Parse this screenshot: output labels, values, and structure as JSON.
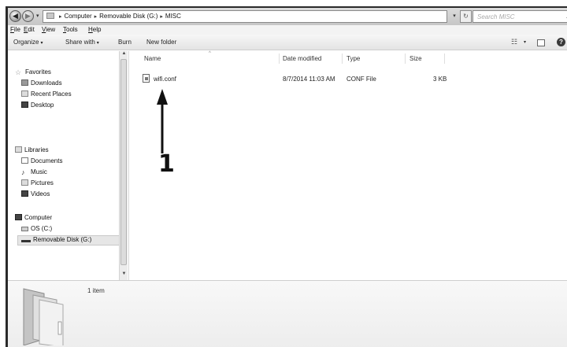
{
  "address_bar": {
    "back_symbol": "◀",
    "forward_symbol": "▶",
    "recent_symbol": "▾",
    "breadcrumbs": [
      "Computer",
      "Removable Disk (G:)",
      "MISC"
    ],
    "separator": "▸",
    "dropdown_symbol": "▾",
    "refresh_symbol": "↻",
    "search_placeholder": "Search MISC",
    "search_icon": "magnifier-icon",
    "search_glyph": "⌕"
  },
  "menu": [
    {
      "key": "F",
      "rest": "ile"
    },
    {
      "key": "E",
      "rest": "dit"
    },
    {
      "key": "V",
      "rest": "iew"
    },
    {
      "key": "T",
      "rest": "ools"
    },
    {
      "key": "H",
      "rest": "elp"
    }
  ],
  "toolbar": {
    "organize": "Organize",
    "share_with": "Share with",
    "burn": "Burn",
    "new_folder": "New folder",
    "caret": "▾",
    "view_glyph": "☷",
    "help_glyph": "?"
  },
  "nav": {
    "favorites": {
      "label": "Favorites",
      "glyph": "☆",
      "items": [
        "Downloads",
        "Recent Places",
        "Desktop"
      ]
    },
    "libraries": {
      "label": "Libraries",
      "items": [
        "Documents",
        "Music",
        "Pictures",
        "Videos"
      ],
      "music_glyph": "♪"
    },
    "computer": {
      "label": "Computer",
      "items": [
        "OS (C:)",
        "Removable Disk (G:)"
      ],
      "selected": "Removable Disk (G:)"
    },
    "scroll_up": "▲",
    "scroll_down": "▼"
  },
  "columns": {
    "name": "Name",
    "date_modified": "Date modified",
    "type": "Type",
    "size": "Size",
    "sort_glyph": "^"
  },
  "files": [
    {
      "name": "wifi.conf",
      "date_modified": "8/7/2014 11:03 AM",
      "type": "CONF File",
      "size": "3 KB"
    }
  ],
  "annotation": {
    "label": "1"
  },
  "details": {
    "item_count": "1 item"
  },
  "colors": {
    "selection": "#e6e6e6",
    "toolbar": "#e4e4e4",
    "annotation": "#111111"
  }
}
